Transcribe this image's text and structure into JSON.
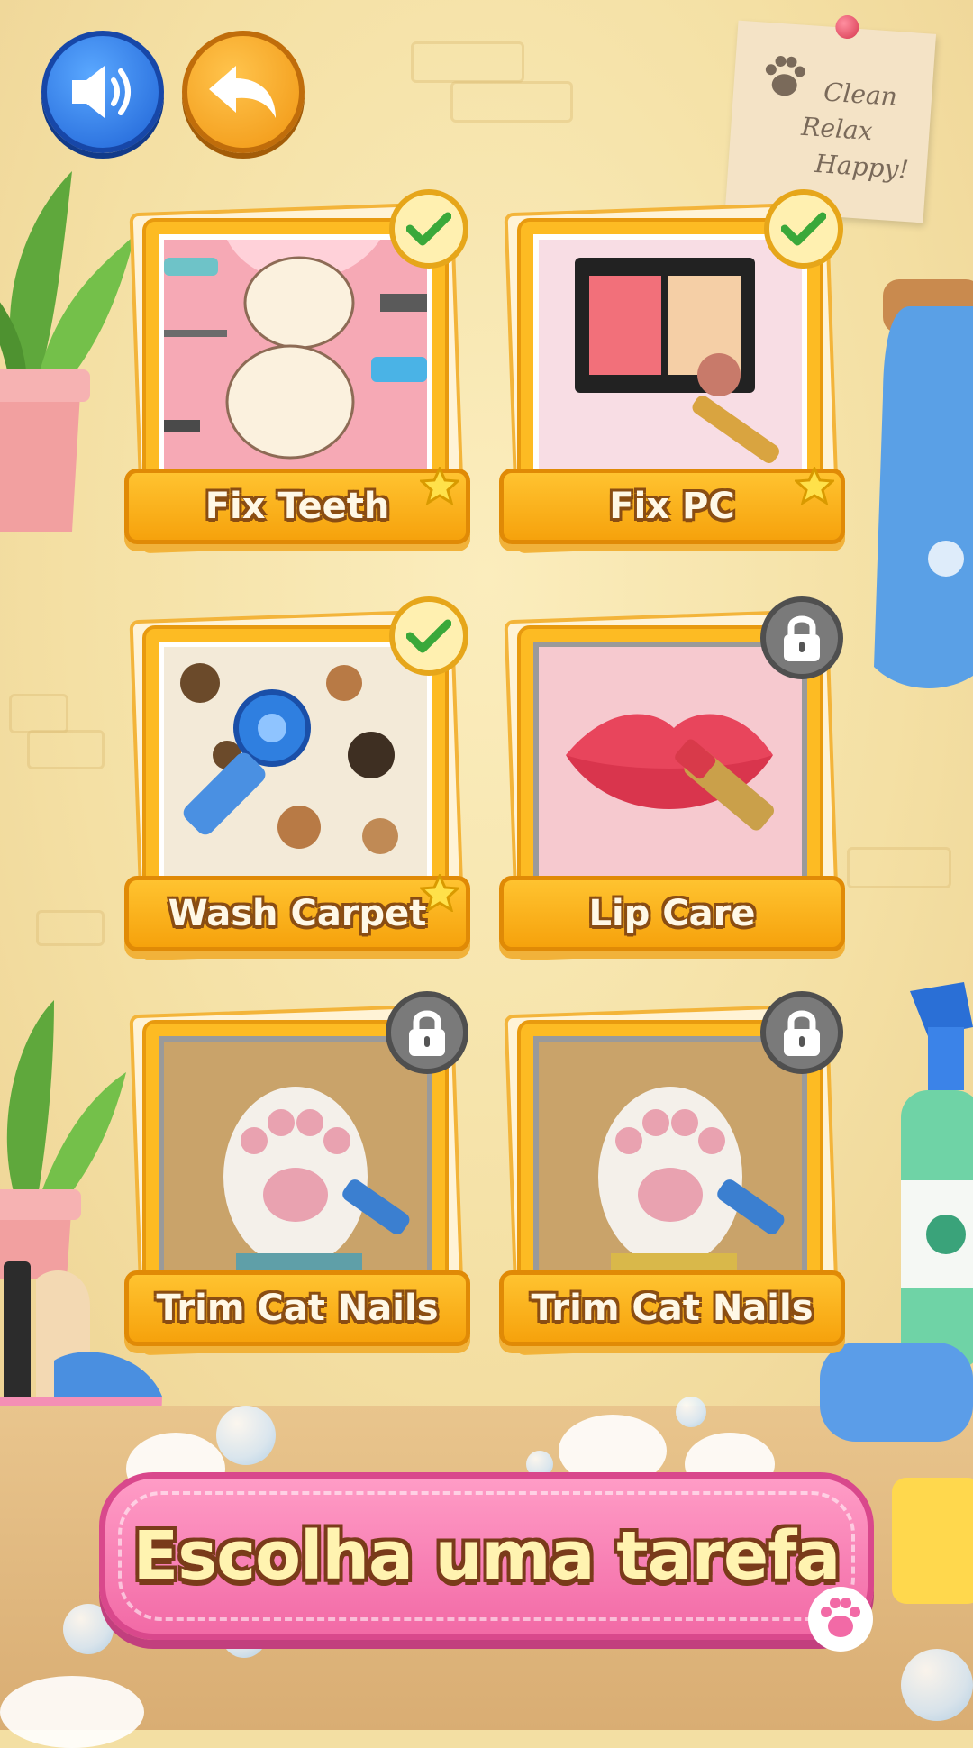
{
  "controls": {
    "sound_icon": "speaker-icon",
    "back_icon": "undo-arrow-icon"
  },
  "note": {
    "line1": "Clean",
    "line2": "Relax",
    "line3": "Happy!"
  },
  "tasks": [
    {
      "label": "Fix Teeth",
      "status": "completed",
      "starred": true,
      "image": "teeth-cleaning-picture"
    },
    {
      "label": "Fix PC",
      "status": "completed",
      "starred": true,
      "image": "makeup-palette-picture"
    },
    {
      "label": "Wash Carpet",
      "status": "completed",
      "starred": true,
      "image": "carpet-cleaning-picture"
    },
    {
      "label": "Lip Care",
      "status": "locked",
      "starred": false,
      "image": "lipstick-picture"
    },
    {
      "label": "Trim Cat Nails",
      "status": "locked",
      "starred": false,
      "image": "cat-paw-picture"
    },
    {
      "label": "Trim Cat Nails",
      "status": "locked",
      "starred": false,
      "image": "cat-paw-picture"
    }
  ],
  "title": "Escolha uma tarefa",
  "colors": {
    "wall": "#f4e0a4",
    "card_frame": "#fdbb23",
    "banner_pink": "#f26aa6",
    "sound_blue": "#1f63d6",
    "back_orange": "#f19612"
  }
}
